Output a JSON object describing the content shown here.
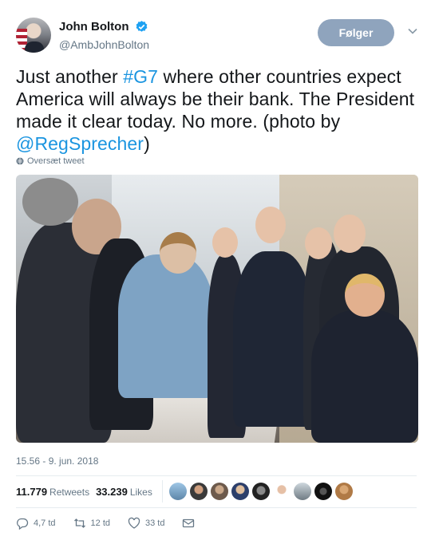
{
  "user": {
    "display_name": "John Bolton",
    "handle": "@AmbJohnBolton",
    "verified_icon": "verified-badge-icon"
  },
  "follow_button": "Følger",
  "tweet": {
    "text_before_hashtag": "Just another ",
    "hashtag": "#G7",
    "text_middle": " where other countries expect America will always be their bank. The President made it clear today. No more. (photo by ",
    "mention": "@RegSprecher",
    "text_end": ")"
  },
  "translate_label": "Oversæt tweet",
  "timestamp": "15.56 - 9. jun. 2018",
  "stats": {
    "retweets_count": "11.779",
    "retweets_label": "Retweets",
    "likes_count": "33.239",
    "likes_label": "Likes"
  },
  "actions": {
    "reply_count": "4,7 td",
    "retweet_count": "12 td",
    "like_count": "33 td"
  },
  "colors": {
    "link": "#1b95e0",
    "follow_button": "#8fa4bd",
    "secondary_text": "#657786"
  }
}
